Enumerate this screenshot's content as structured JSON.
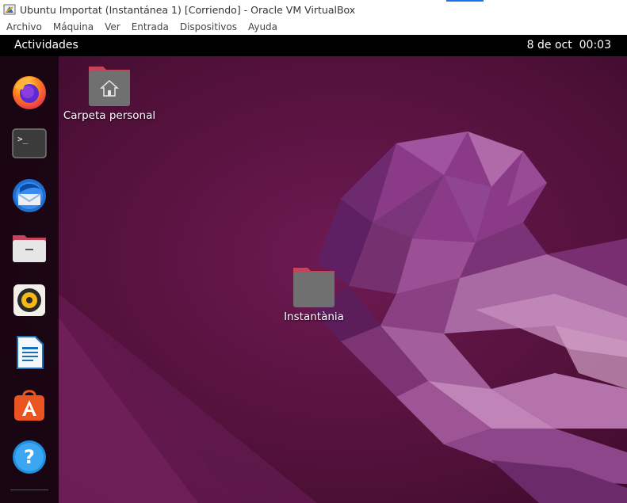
{
  "window": {
    "title": "Ubuntu Importat (Instantánea 1) [Corriendo] - Oracle VM VirtualBox",
    "app_icon": "virtualbox-icon"
  },
  "menubar": {
    "items": [
      "Archivo",
      "Máquina",
      "Ver",
      "Entrada",
      "Dispositivos",
      "Ayuda"
    ]
  },
  "topbar": {
    "activities_label": "Actividades",
    "date": "8 de oct",
    "time": "00:03"
  },
  "dock": {
    "items": [
      {
        "name": "Firefox",
        "icon": "firefox-icon"
      },
      {
        "name": "Terminal",
        "icon": "terminal-icon"
      },
      {
        "name": "Thunderbird",
        "icon": "thunderbird-icon"
      },
      {
        "name": "Archivos",
        "icon": "files-icon"
      },
      {
        "name": "Rhythmbox",
        "icon": "rhythmbox-icon"
      },
      {
        "name": "LibreOffice Writer",
        "icon": "writer-icon"
      },
      {
        "name": "Ubuntu Software",
        "icon": "software-icon"
      },
      {
        "name": "Ayuda",
        "icon": "help-icon"
      }
    ]
  },
  "desktop": {
    "icons": [
      {
        "label": "Carpeta personal",
        "icon": "home-folder-icon"
      },
      {
        "label": "Instantània",
        "icon": "folder-icon"
      }
    ]
  },
  "colors": {
    "wallpaper_base": "#5a1444",
    "topbar": "#000000",
    "folder_body": "#6e6e6e",
    "folder_tab": "#c7425b",
    "accent_orange": "#e95420"
  }
}
